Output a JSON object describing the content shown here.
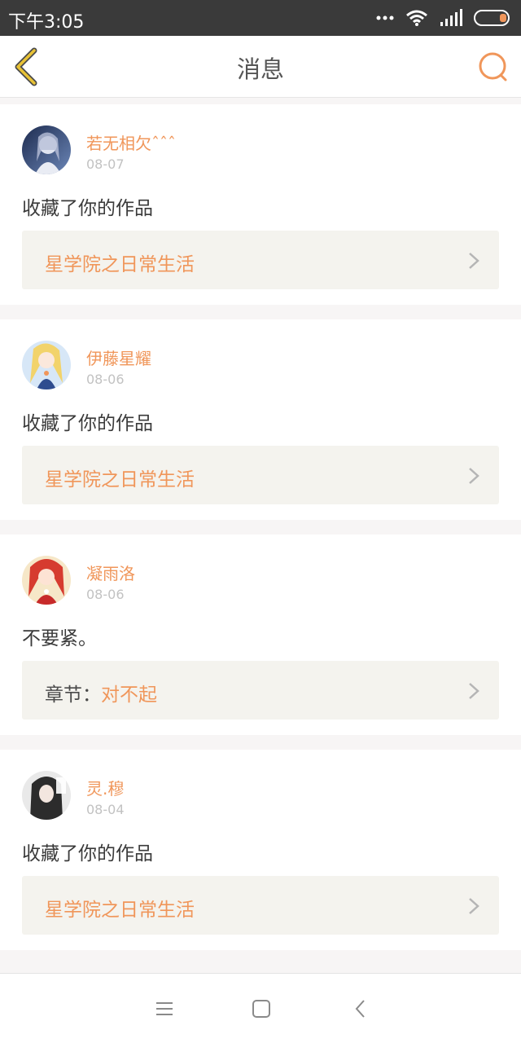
{
  "statusbar": {
    "time": "下午3:05"
  },
  "header": {
    "title": "消息"
  },
  "messages": [
    {
      "user": "若无相欠ˆˆˆ",
      "date": "08-07",
      "text": "收藏了你的作品",
      "link_prefix": "",
      "link_text": "星学院之日常生活"
    },
    {
      "user": "伊藤星耀",
      "date": "08-06",
      "text": "收藏了你的作品",
      "link_prefix": "",
      "link_text": "星学院之日常生活"
    },
    {
      "user": "凝雨洛",
      "date": "08-06",
      "text": "不要紧。",
      "link_prefix": "章节：",
      "link_text": "对不起"
    },
    {
      "user": "灵.穆",
      "date": "08-04",
      "text": "收藏了你的作品",
      "link_prefix": "",
      "link_text": "星学院之日常生活"
    }
  ],
  "colors": {
    "accent": "#f0965a",
    "back_arrow": "#e8c235"
  },
  "icons": [
    "chevron-left-icon",
    "search-icon",
    "chevron-right-icon",
    "menu-icon",
    "home-icon",
    "back-icon",
    "wifi-icon",
    "signal-icon",
    "battery-icon"
  ]
}
